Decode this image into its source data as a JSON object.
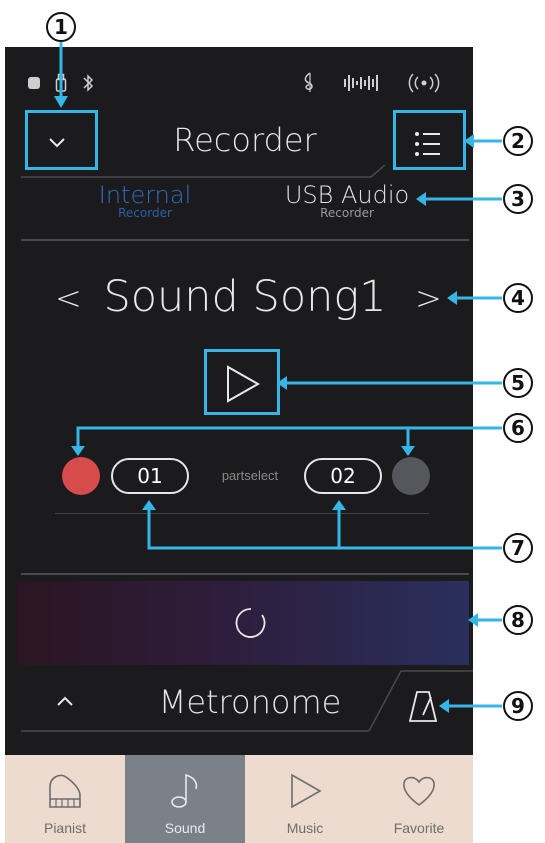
{
  "status_bar": {
    "icons": [
      "app-icon",
      "usb-stick-icon",
      "bluetooth-icon",
      "music-clef-icon",
      "sound-wave-icon",
      "wireless-icon"
    ]
  },
  "header": {
    "title": "Recorder"
  },
  "recorder_tabs": [
    {
      "label": "Internal",
      "sub": "Recorder",
      "active": true
    },
    {
      "label": "USB Audio",
      "sub": "Recorder",
      "active": false
    }
  ],
  "song": {
    "name": "Sound Song1",
    "prev": "<",
    "next": ">"
  },
  "parts": {
    "part1": "01",
    "part2": "02",
    "label": "partselect"
  },
  "metronome": {
    "label": "Metronome"
  },
  "bottom_tabs": [
    {
      "label": "Pianist",
      "selected": false
    },
    {
      "label": "Sound",
      "selected": true
    },
    {
      "label": "Music",
      "selected": false
    },
    {
      "label": "Favorite",
      "selected": false
    }
  ],
  "callouts": [
    "1",
    "2",
    "3",
    "4",
    "5",
    "6",
    "7",
    "8",
    "9"
  ],
  "colors": {
    "accent": "#35b6e6",
    "record_part1": "#d84b4b",
    "record_part2": "#55575c",
    "screen_bg": "#1b1b1d",
    "tab_bar": "#ecdbce",
    "tab_selected": "#7b8188",
    "inactive_tab_text": "#2f6dc0"
  }
}
